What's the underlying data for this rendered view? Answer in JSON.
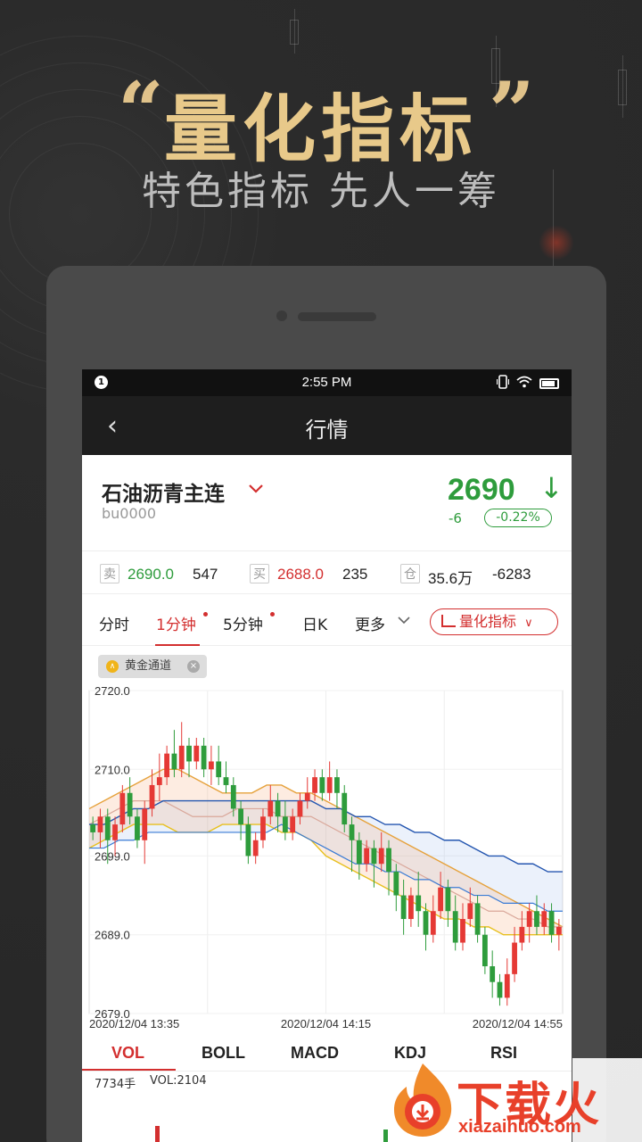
{
  "promo": {
    "title": "量化指标",
    "open_quote": "“",
    "close_quote": "”",
    "subtitle": "特色指标 先人一筹"
  },
  "status_bar": {
    "time": "2:55 PM",
    "notification": "1"
  },
  "nav": {
    "back_icon": "‹",
    "title": "行情"
  },
  "quote": {
    "name": "石油沥青主连",
    "code": "bu0000",
    "last_price": "2690",
    "arrow": "↓",
    "change": "-6",
    "change_pct": "-0.22%",
    "down_color": "#2e9c3c",
    "up_color": "#d32f2f"
  },
  "book": {
    "sell_tag": "卖",
    "sell_price": "2690.0",
    "sell_vol": "547",
    "buy_tag": "买",
    "buy_price": "2688.0",
    "buy_vol": "235",
    "oi_tag": "仓",
    "oi_value": "35.6万",
    "oi_change": "-6283"
  },
  "period_tabs": [
    {
      "label": "分时"
    },
    {
      "label": "1分钟"
    },
    {
      "label": "5分钟"
    },
    {
      "label": "日K"
    },
    {
      "label": "更多"
    }
  ],
  "indicator_button": "量化指标",
  "indicator_button_chevron": "∨",
  "chip": {
    "icon": "∧",
    "label": "黄金通道",
    "close": "×"
  },
  "chart_data": {
    "type": "candlestick",
    "y_ticks": [
      "2720.0",
      "2710.0",
      "2699.0",
      "2689.0",
      "2679.0"
    ],
    "ylim": [
      2679,
      2720
    ],
    "x_ticks": [
      "2020/12/04 13:35",
      "2020/12/04 14:15",
      "2020/12/04 14:55"
    ],
    "candles": [
      {
        "o": 2703,
        "c": 2702,
        "h": 2704,
        "l": 2701
      },
      {
        "o": 2702,
        "c": 2704,
        "h": 2705,
        "l": 2700
      },
      {
        "o": 2704,
        "c": 2701,
        "h": 2705,
        "l": 2698
      },
      {
        "o": 2701,
        "c": 2703,
        "h": 2704,
        "l": 2699
      },
      {
        "o": 2703,
        "c": 2707,
        "h": 2708,
        "l": 2702
      },
      {
        "o": 2707,
        "c": 2704,
        "h": 2709,
        "l": 2703
      },
      {
        "o": 2704,
        "c": 2701,
        "h": 2705,
        "l": 2700
      },
      {
        "o": 2701,
        "c": 2705,
        "h": 2706,
        "l": 2698
      },
      {
        "o": 2705,
        "c": 2708,
        "h": 2710,
        "l": 2704
      },
      {
        "o": 2708,
        "c": 2709,
        "h": 2712,
        "l": 2706
      },
      {
        "o": 2709,
        "c": 2712,
        "h": 2713,
        "l": 2708
      },
      {
        "o": 2712,
        "c": 2710,
        "h": 2715,
        "l": 2709
      },
      {
        "o": 2710,
        "c": 2713,
        "h": 2716,
        "l": 2709
      },
      {
        "o": 2713,
        "c": 2711,
        "h": 2714,
        "l": 2709
      },
      {
        "o": 2711,
        "c": 2713,
        "h": 2714,
        "l": 2710
      },
      {
        "o": 2713,
        "c": 2710,
        "h": 2714,
        "l": 2709
      },
      {
        "o": 2710,
        "c": 2711,
        "h": 2713,
        "l": 2708
      },
      {
        "o": 2711,
        "c": 2709,
        "h": 2713,
        "l": 2708
      },
      {
        "o": 2709,
        "c": 2708,
        "h": 2711,
        "l": 2707
      },
      {
        "o": 2708,
        "c": 2705,
        "h": 2709,
        "l": 2704
      },
      {
        "o": 2705,
        "c": 2703,
        "h": 2706,
        "l": 2701
      },
      {
        "o": 2703,
        "c": 2699,
        "h": 2704,
        "l": 2698
      },
      {
        "o": 2699,
        "c": 2701,
        "h": 2702,
        "l": 2698
      },
      {
        "o": 2701,
        "c": 2704,
        "h": 2705,
        "l": 2700
      },
      {
        "o": 2704,
        "c": 2706,
        "h": 2708,
        "l": 2703
      },
      {
        "o": 2706,
        "c": 2704,
        "h": 2707,
        "l": 2702
      },
      {
        "o": 2704,
        "c": 2702,
        "h": 2706,
        "l": 2701
      },
      {
        "o": 2702,
        "c": 2704,
        "h": 2705,
        "l": 2701
      },
      {
        "o": 2704,
        "c": 2706,
        "h": 2707,
        "l": 2703
      },
      {
        "o": 2706,
        "c": 2707,
        "h": 2709,
        "l": 2705
      },
      {
        "o": 2707,
        "c": 2709,
        "h": 2710,
        "l": 2706
      },
      {
        "o": 2709,
        "c": 2707,
        "h": 2710,
        "l": 2706
      },
      {
        "o": 2707,
        "c": 2709,
        "h": 2711,
        "l": 2706
      },
      {
        "o": 2709,
        "c": 2707,
        "h": 2710,
        "l": 2705
      },
      {
        "o": 2707,
        "c": 2703,
        "h": 2708,
        "l": 2702
      },
      {
        "o": 2703,
        "c": 2701,
        "h": 2704,
        "l": 2697
      },
      {
        "o": 2701,
        "c": 2698,
        "h": 2702,
        "l": 2696
      },
      {
        "o": 2698,
        "c": 2700,
        "h": 2701,
        "l": 2697
      },
      {
        "o": 2700,
        "c": 2698,
        "h": 2701,
        "l": 2695
      },
      {
        "o": 2698,
        "c": 2700,
        "h": 2702,
        "l": 2697
      },
      {
        "o": 2700,
        "c": 2697,
        "h": 2701,
        "l": 2694
      },
      {
        "o": 2697,
        "c": 2694,
        "h": 2698,
        "l": 2692
      },
      {
        "o": 2694,
        "c": 2691,
        "h": 2696,
        "l": 2689
      },
      {
        "o": 2691,
        "c": 2694,
        "h": 2695,
        "l": 2690
      },
      {
        "o": 2694,
        "c": 2692,
        "h": 2697,
        "l": 2690
      },
      {
        "o": 2692,
        "c": 2689,
        "h": 2693,
        "l": 2687
      },
      {
        "o": 2689,
        "c": 2692,
        "h": 2694,
        "l": 2688
      },
      {
        "o": 2692,
        "c": 2695,
        "h": 2697,
        "l": 2691
      },
      {
        "o": 2695,
        "c": 2692,
        "h": 2696,
        "l": 2690
      },
      {
        "o": 2692,
        "c": 2688,
        "h": 2694,
        "l": 2687
      },
      {
        "o": 2688,
        "c": 2691,
        "h": 2693,
        "l": 2687
      },
      {
        "o": 2691,
        "c": 2693,
        "h": 2695,
        "l": 2690
      },
      {
        "o": 2693,
        "c": 2689,
        "h": 2694,
        "l": 2688
      },
      {
        "o": 2689,
        "c": 2685,
        "h": 2690,
        "l": 2684
      },
      {
        "o": 2685,
        "c": 2683,
        "h": 2687,
        "l": 2681
      },
      {
        "o": 2683,
        "c": 2681,
        "h": 2684,
        "l": 2680
      },
      {
        "o": 2681,
        "c": 2684,
        "h": 2686,
        "l": 2680
      },
      {
        "o": 2684,
        "c": 2688,
        "h": 2690,
        "l": 2683
      },
      {
        "o": 2688,
        "c": 2690,
        "h": 2692,
        "l": 2687
      },
      {
        "o": 2690,
        "c": 2692,
        "h": 2693,
        "l": 2688
      },
      {
        "o": 2692,
        "c": 2690,
        "h": 2694,
        "l": 2689
      },
      {
        "o": 2690,
        "c": 2692,
        "h": 2693,
        "l": 2689
      },
      {
        "o": 2692,
        "c": 2689,
        "h": 2693,
        "l": 2688
      },
      {
        "o": 2689,
        "c": 2690,
        "h": 2691,
        "l": 2687
      }
    ],
    "upper_band": [
      2705,
      2706,
      2707,
      2708,
      2709,
      2710,
      2710,
      2709,
      2708,
      2707,
      2707,
      2707,
      2708,
      2708,
      2707,
      2707,
      2706,
      2705,
      2704,
      2703,
      2702,
      2701,
      2700,
      2699,
      2698,
      2697,
      2696,
      2695,
      2694,
      2693,
      2692,
      2691,
      2690
    ],
    "middle_band": [
      2703,
      2704,
      2705,
      2706,
      2706,
      2706,
      2705,
      2704,
      2704,
      2704,
      2705,
      2705,
      2705,
      2704,
      2704,
      2704,
      2703,
      2702,
      2701,
      2700,
      2699,
      2698,
      2697,
      2696,
      2695,
      2694,
      2693,
      2692,
      2692,
      2691,
      2691,
      2690,
      2690
    ],
    "lower_band": [
      2700,
      2701,
      2702,
      2703,
      2703,
      2703,
      2702,
      2702,
      2702,
      2703,
      2703,
      2703,
      2703,
      2702,
      2702,
      2701,
      2699,
      2698,
      2697,
      2696,
      2695,
      2694,
      2693,
      2692,
      2691,
      2691,
      2690,
      2690,
      2689,
      2689,
      2689,
      2689,
      2689
    ],
    "blue_upper": [
      2703,
      2703,
      2704,
      2705,
      2705,
      2706,
      2706,
      2706,
      2706,
      2706,
      2706,
      2706,
      2706,
      2706,
      2706,
      2706,
      2705,
      2705,
      2704,
      2704,
      2703,
      2703,
      2702,
      2702,
      2701,
      2701,
      2700,
      2699,
      2699,
      2698,
      2698,
      2697,
      2697
    ],
    "blue_lower": [
      2700,
      2700,
      2701,
      2701,
      2702,
      2702,
      2702,
      2702,
      2702,
      2702,
      2702,
      2702,
      2702,
      2703,
      2702,
      2701,
      2700,
      2699,
      2698,
      2698,
      2697,
      2697,
      2696,
      2696,
      2695,
      2695,
      2694,
      2694,
      2693,
      2693,
      2693,
      2692,
      2692
    ]
  },
  "indicator_tabs": [
    {
      "label": "VOL"
    },
    {
      "label": "BOLL"
    },
    {
      "label": "MACD"
    },
    {
      "label": "KDJ"
    },
    {
      "label": "RSI"
    }
  ],
  "volume": {
    "max_label": "7734手",
    "vol_label": "VOL:2104"
  },
  "watermark": {
    "brand": "下载火",
    "url": "xiazaihuo.com"
  }
}
